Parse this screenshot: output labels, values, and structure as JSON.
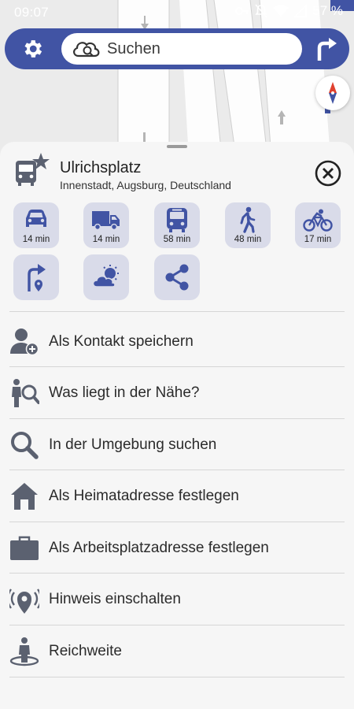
{
  "status_bar": {
    "time": "09:07",
    "battery": "57 %",
    "icons": [
      "vpn-key-icon",
      "mute-icon",
      "wifi-icon",
      "signal-icon"
    ]
  },
  "search": {
    "placeholder": "Suchen",
    "left_icon": "gear-icon",
    "right_icon": "route-turn-icon"
  },
  "place": {
    "name": "Ulrichsplatz",
    "address": "Innenstadt, Augsburg, Deutschland",
    "icon": "bus-stop-favorite-icon"
  },
  "travel_modes": [
    {
      "mode": "car",
      "time": "14 min",
      "icon": "car-icon"
    },
    {
      "mode": "truck",
      "time": "14 min",
      "icon": "truck-icon"
    },
    {
      "mode": "public-transport",
      "time": "58 min",
      "icon": "bus-icon"
    },
    {
      "mode": "walk",
      "time": "48 min",
      "icon": "walk-icon"
    },
    {
      "mode": "bike",
      "time": "17 min",
      "icon": "bike-icon"
    }
  ],
  "actions": [
    {
      "name": "navigate",
      "icon": "turn-right-pin-icon"
    },
    {
      "name": "weather",
      "icon": "weather-icon"
    },
    {
      "name": "share",
      "icon": "share-icon"
    }
  ],
  "menu": [
    {
      "label": "Als Kontakt speichern",
      "icon": "add-contact-icon"
    },
    {
      "label": "Was liegt in der Nähe?",
      "icon": "person-search-icon"
    },
    {
      "label": "In der Umgebung suchen",
      "icon": "magnifier-icon"
    },
    {
      "label": "Als Heimatadresse festlegen",
      "icon": "home-icon"
    },
    {
      "label": "Als Arbeitsplatzadresse festlegen",
      "icon": "briefcase-icon"
    },
    {
      "label": "Hinweis einschalten",
      "icon": "location-alert-icon"
    },
    {
      "label": "Reichweite",
      "icon": "range-person-icon"
    }
  ],
  "colors": {
    "brand": "#4154a4",
    "icon_gray": "#5b6170",
    "tile_bg": "#d9dbe9",
    "sheet_bg": "#f6f6f6"
  }
}
